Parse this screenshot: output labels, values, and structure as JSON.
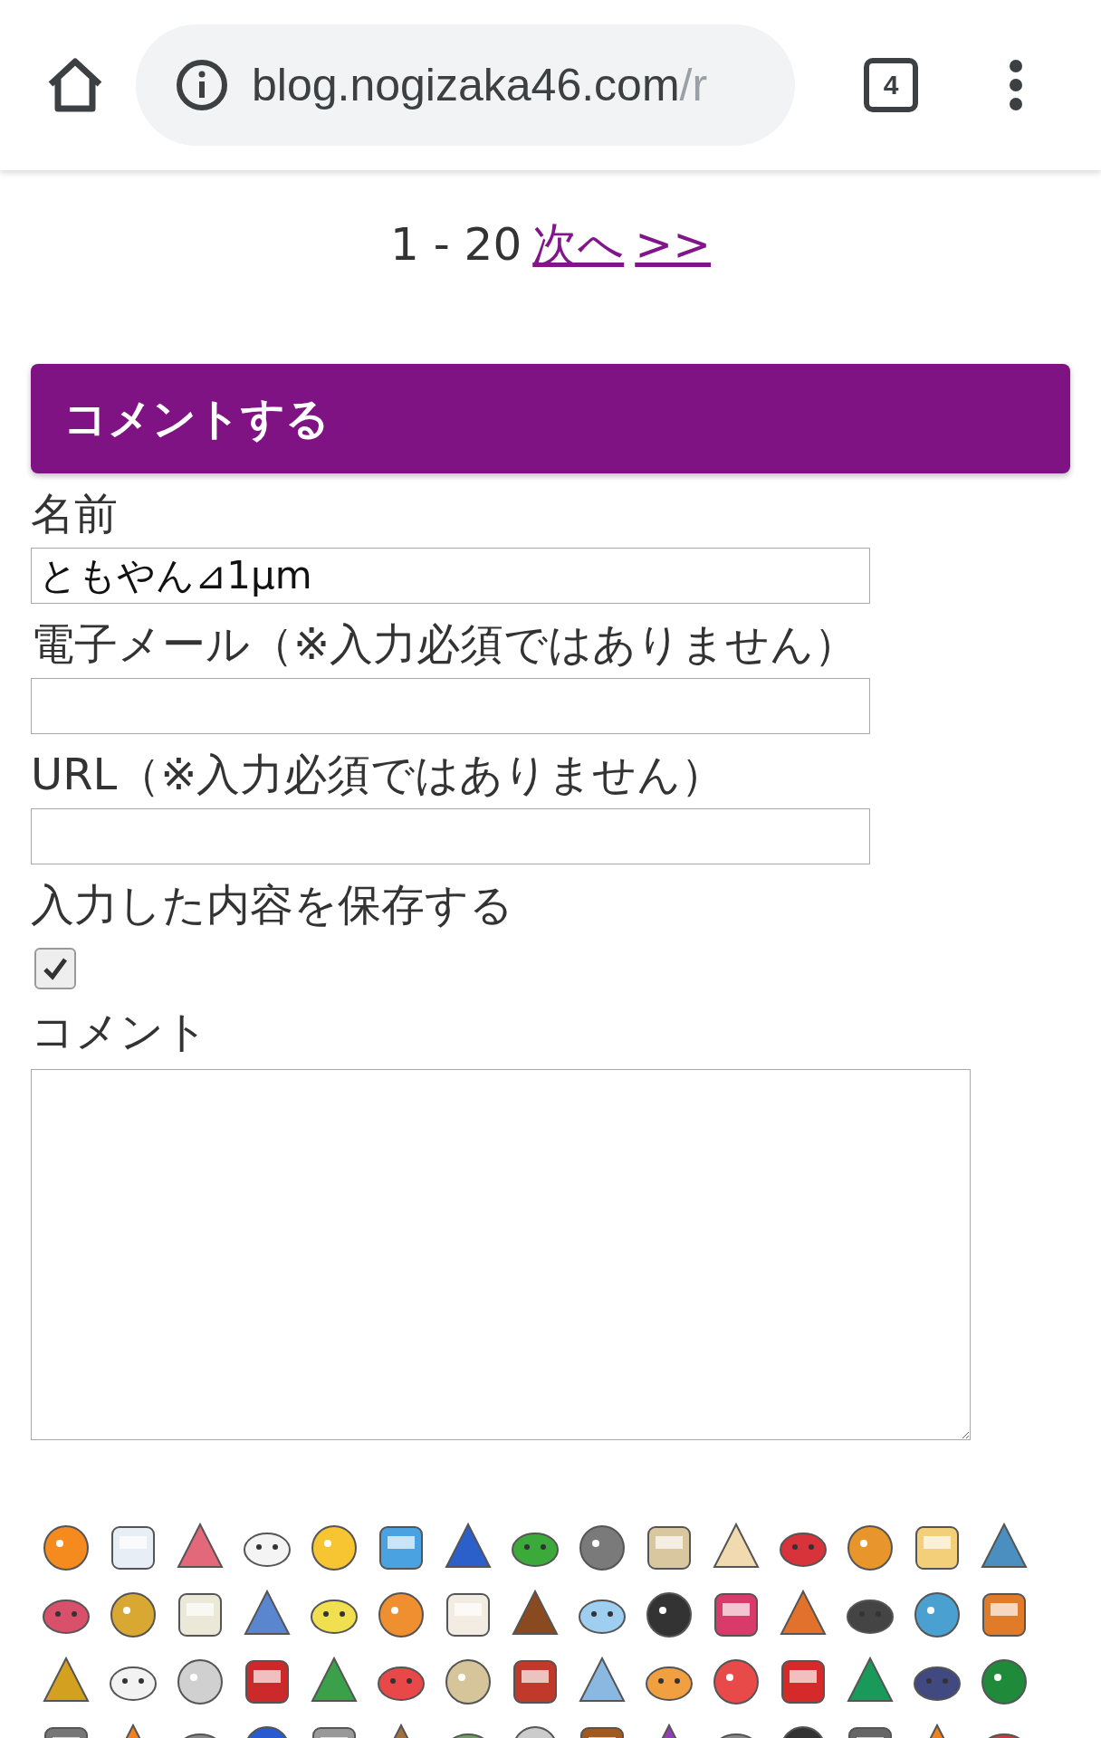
{
  "browser": {
    "url_host": "blog.nogizaka46.com",
    "url_rest": "/r",
    "tab_count": "4"
  },
  "pagination": {
    "range": "1 - 20",
    "next": "次へ",
    "last": ">>"
  },
  "comment_form": {
    "title": "コメントする",
    "fields": [
      {
        "kind": "text",
        "label": "名前",
        "value": "ともやん⊿1μm"
      },
      {
        "kind": "text",
        "label": "電子メール（※入力必須ではありません）"
      },
      {
        "kind": "text",
        "label": "URL（※入力必須ではありません）"
      },
      {
        "kind": "checkbox",
        "label": "入力した内容を保存する",
        "checked": true
      },
      {
        "kind": "textarea",
        "label": "コメント"
      }
    ]
  }
}
